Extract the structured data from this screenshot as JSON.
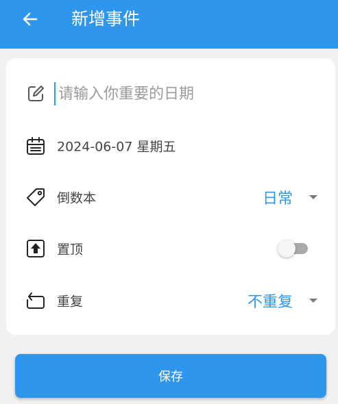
{
  "app_bar": {
    "title": "新增事件",
    "icons": {
      "back": "arrow-left-icon"
    },
    "color": "#2f96ee"
  },
  "form": {
    "title_field": {
      "placeholder": "请输入你重要的日期",
      "value": "",
      "icon": "edit-icon"
    },
    "date_row": {
      "text": "2024-06-07 星期五",
      "icon": "calendar-icon"
    },
    "category_row": {
      "label": "倒数本",
      "value": "日常",
      "icon": "tag-icon"
    },
    "pin_row": {
      "label": "置顶",
      "enabled": false,
      "icon": "pin-top-icon"
    },
    "repeat_row": {
      "label": "重复",
      "value": "不重复",
      "icon": "repeat-icon"
    }
  },
  "save_button": {
    "label": "保存"
  },
  "colors": {
    "accent": "#2f96ee",
    "background": "#f1f1f1",
    "card": "#ffffff",
    "toggle_off": "#a9a9a9"
  }
}
